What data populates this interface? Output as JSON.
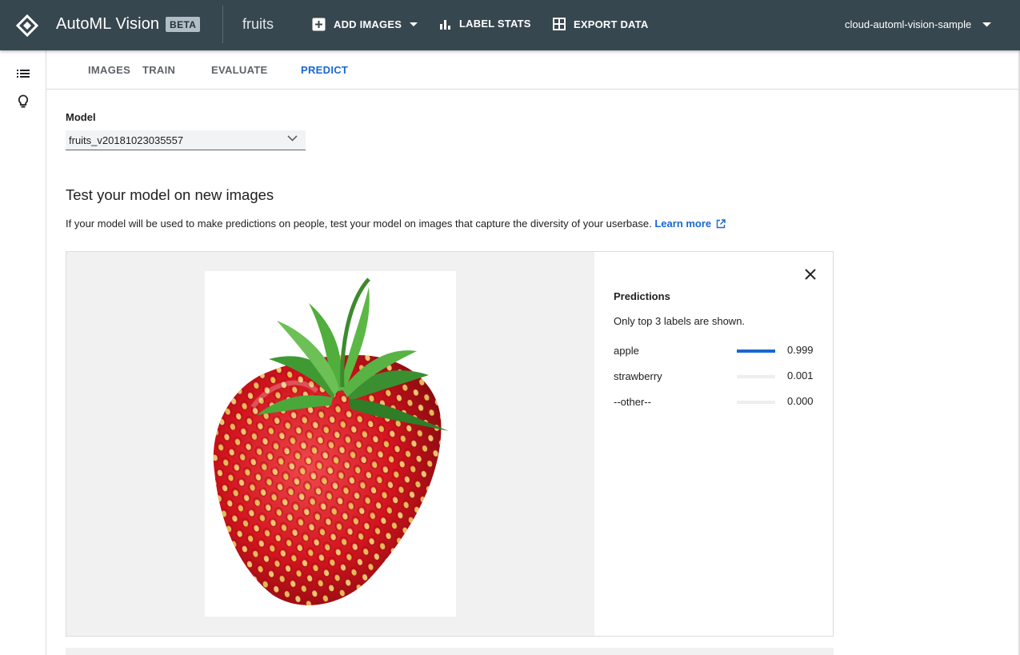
{
  "header": {
    "app_title": "AutoML Vision",
    "badge": "BETA",
    "dataset": "fruits",
    "add_images": "ADD IMAGES",
    "label_stats": "LABEL STATS",
    "export_data": "EXPORT DATA",
    "project": "cloud-automl-vision-sample"
  },
  "tabs": [
    "IMAGES",
    "TRAIN",
    "EVALUATE",
    "PREDICT"
  ],
  "active_tab": "PREDICT",
  "model": {
    "label": "Model",
    "selected": "fruits_v20181023035557"
  },
  "test": {
    "heading": "Test your model on new images",
    "description": "If your model will be used to make predictions on people, test your model on images that capture the diversity of your userbase.",
    "learn_more": "Learn more"
  },
  "predictions": {
    "title": "Predictions",
    "note": "Only top 3 labels are shown.",
    "rows": [
      {
        "label": "apple",
        "score": "0.999",
        "fraction": 0.999
      },
      {
        "label": "strawberry",
        "score": "0.001",
        "fraction": 0.001
      },
      {
        "label": "--other--",
        "score": "0.000",
        "fraction": 0.0
      }
    ]
  },
  "icons": [
    "automl-logo-icon",
    "add-box-icon",
    "dropdown-arrow-icon",
    "bar-chart-icon",
    "grid-icon",
    "list-icon",
    "lightbulb-icon",
    "chevron-down-icon",
    "external-link-icon",
    "close-icon"
  ],
  "colors": {
    "topbar": "#37474f",
    "accent": "#1967d2"
  }
}
